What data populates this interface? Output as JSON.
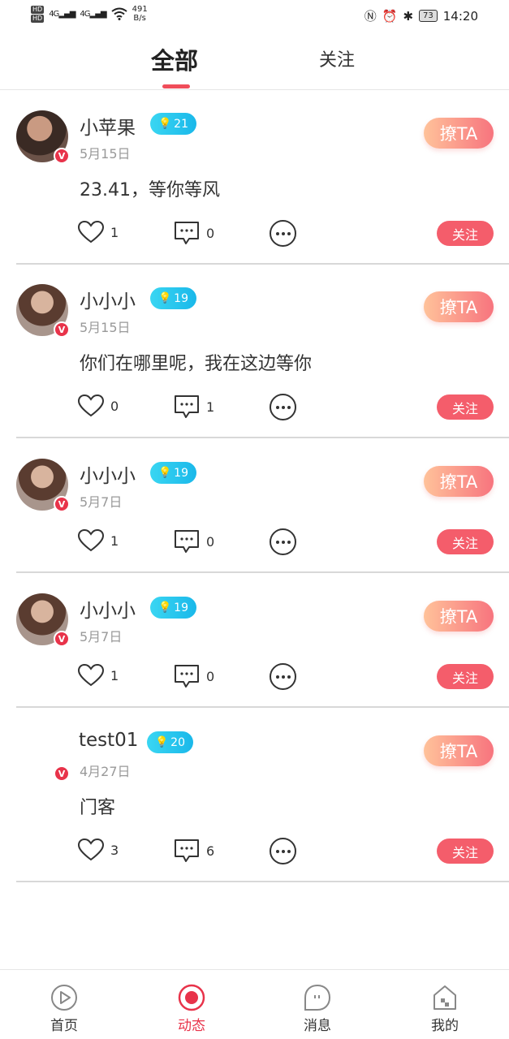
{
  "status_bar": {
    "hd1": "HD",
    "hd2": "HD",
    "signal1": "4G",
    "signal2": "4G",
    "speed_value": "491",
    "speed_unit": "B/s",
    "battery": "73",
    "time": "14:20"
  },
  "tabs": [
    {
      "label": "全部",
      "active": true
    },
    {
      "label": "关注",
      "active": false
    }
  ],
  "posts": [
    {
      "username": "小苹果",
      "level": "21",
      "date": "5月15日",
      "content": "23.41，等你等风",
      "likes": "1",
      "comments": "0",
      "flirt_label": "撩TA",
      "follow_label": "关注"
    },
    {
      "username": "小小小",
      "level": "19",
      "date": "5月15日",
      "content": "你们在哪里呢，我在这边等你",
      "likes": "0",
      "comments": "1",
      "flirt_label": "撩TA",
      "follow_label": "关注"
    },
    {
      "username": "小小小",
      "level": "19",
      "date": "5月7日",
      "content": "",
      "likes": "1",
      "comments": "0",
      "flirt_label": "撩TA",
      "follow_label": "关注"
    },
    {
      "username": "小小小",
      "level": "19",
      "date": "5月7日",
      "content": "",
      "likes": "1",
      "comments": "0",
      "flirt_label": "撩TA",
      "follow_label": "关注"
    },
    {
      "username": "test01",
      "level": "20",
      "date": "4月27日",
      "content": "门客",
      "likes": "3",
      "comments": "6",
      "flirt_label": "撩TA",
      "follow_label": "关注"
    }
  ],
  "bottom_nav": [
    {
      "label": "首页",
      "icon": "play-circle-icon",
      "active": false
    },
    {
      "label": "动态",
      "icon": "dynamic-circle-icon",
      "active": true
    },
    {
      "label": "消息",
      "icon": "message-bubble-icon",
      "active": false
    },
    {
      "label": "我的",
      "icon": "home-icon",
      "active": false
    }
  ],
  "colors": {
    "accent": "#e8334a",
    "follow_button": "#f45d6b",
    "level_badge": "#1ab8ea",
    "flirt_gradient_start": "#ffc29a",
    "flirt_gradient_end": "#f7747e"
  }
}
